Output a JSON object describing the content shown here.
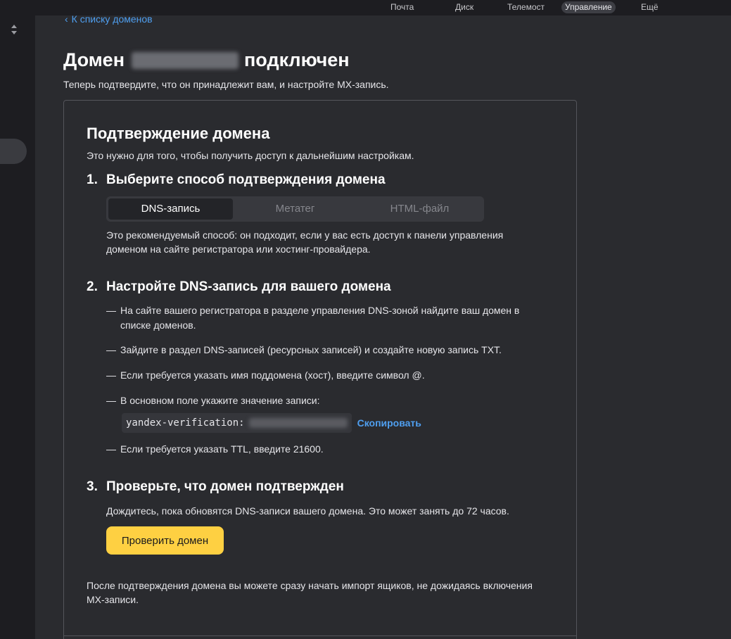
{
  "topnav": {
    "items": [
      {
        "label": "Почта",
        "active": false
      },
      {
        "label": "Диск",
        "active": false
      },
      {
        "label": "Телемост",
        "active": false
      },
      {
        "label": "Управление",
        "active": true
      },
      {
        "label": "Ещё",
        "active": false
      }
    ]
  },
  "back_link": "К списку доменов",
  "page": {
    "title_prefix": "Домен",
    "title_suffix": "подключен",
    "subtitle": "Теперь подтвердите, что он принадлежит вам, и настройте MX-запись."
  },
  "card": {
    "title": "Подтверждение домена",
    "description": "Это нужно для того, чтобы получить доступ к дальнейшим настройкам.",
    "step1": {
      "number": "1.",
      "title": "Выберите способ подтверждения домена",
      "options": [
        "DNS-запись",
        "Метатег",
        "HTML-файл"
      ],
      "selected": "DNS-запись",
      "note": "Это рекомендуемый способ: он подходит, если у вас есть доступ к панели управления доменом на сайте регистратора или хостинг-провайдера."
    },
    "step2": {
      "number": "2.",
      "title": "Настройте DNS-запись для вашего домена",
      "bullets": [
        "На сайте вашего регистратора в разделе управления DNS-зоной найдите ваш домен в списке доменов.",
        "Зайдите в раздел DNS-записей (ресурсных записей) и создайте новую запись TXT.",
        "Если требуется указать имя поддомена (хост), введите символ @.",
        "В основном поле укажите значение записи:",
        "Если требуется указать TTL, введите 21600."
      ],
      "dash": "—",
      "code_prefix": "yandex-verification:",
      "copy_label": "Скопировать"
    },
    "step3": {
      "number": "3.",
      "title": "Проверьте, что домен подтвержден",
      "note": "Дождитесь, пока обновятся DNS-записи вашего домена. Это может занять до 72 часов.",
      "button": "Проверить домен"
    },
    "footer_note": "После подтверждения домена вы можете сразу начать импорт ящиков, не дожидаясь включения MX-записи."
  },
  "colors": {
    "accent_link": "#4f9ff0",
    "button_yellow": "#fed042",
    "background": "#2a2b2f"
  }
}
